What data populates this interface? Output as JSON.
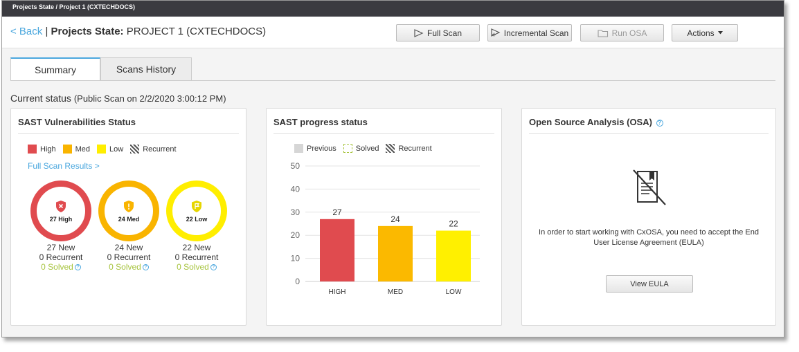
{
  "topbar": {
    "breadcrumb": "Projects State / Project 1 (CXTECHDOCS)"
  },
  "header": {
    "back_label": "< Back",
    "separator": " | ",
    "title_bold": "Projects State:",
    "title_project": " PROJECT 1 (CXTECHDOCS)",
    "buttons": {
      "full_scan": "Full Scan",
      "incremental_scan": "Incremental Scan",
      "run_osa": "Run OSA",
      "actions": "Actions"
    }
  },
  "tabs": [
    {
      "label": "Summary",
      "active": true
    },
    {
      "label": "Scans History",
      "active": false
    }
  ],
  "current_status": {
    "label": "Current status",
    "detail": "(Public Scan on 2/2/2020 3:00:12 PM)"
  },
  "sast_vuln": {
    "title": "SAST Vulnerabilities Status",
    "legend": {
      "high": "High",
      "med": "Med",
      "low": "Low",
      "recurrent": "Recurrent"
    },
    "link": "Full Scan Results >",
    "rings": [
      {
        "label": "27 High",
        "new": "27 New",
        "recurrent": "0 Recurrent",
        "solved": "0 Solved",
        "color": "#e04b4f"
      },
      {
        "label": "24 Med",
        "new": "24 New",
        "recurrent": "0 Recurrent",
        "solved": "0 Solved",
        "color": "#f9b400"
      },
      {
        "label": "22 Low",
        "new": "22 New",
        "recurrent": "0 Recurrent",
        "solved": "0 Solved",
        "color": "#ffee00"
      }
    ]
  },
  "sast_progress": {
    "title": "SAST progress status",
    "legend": {
      "previous": "Previous",
      "solved": "Solved",
      "recurrent": "Recurrent"
    }
  },
  "chart_data": {
    "type": "bar",
    "categories": [
      "HIGH",
      "MED",
      "LOW"
    ],
    "values": [
      27,
      24,
      22
    ],
    "colors": [
      "#e04b4f",
      "#fbb900",
      "#fff000"
    ],
    "ylim": [
      0,
      50
    ],
    "yticks": [
      0,
      10,
      20,
      30,
      40,
      50
    ],
    "grid": true
  },
  "osa": {
    "title": "Open Source Analysis (OSA)",
    "message": "In order to start working with CxOSA, you need to accept the End User License Agreement (EULA)",
    "button": "View EULA"
  }
}
